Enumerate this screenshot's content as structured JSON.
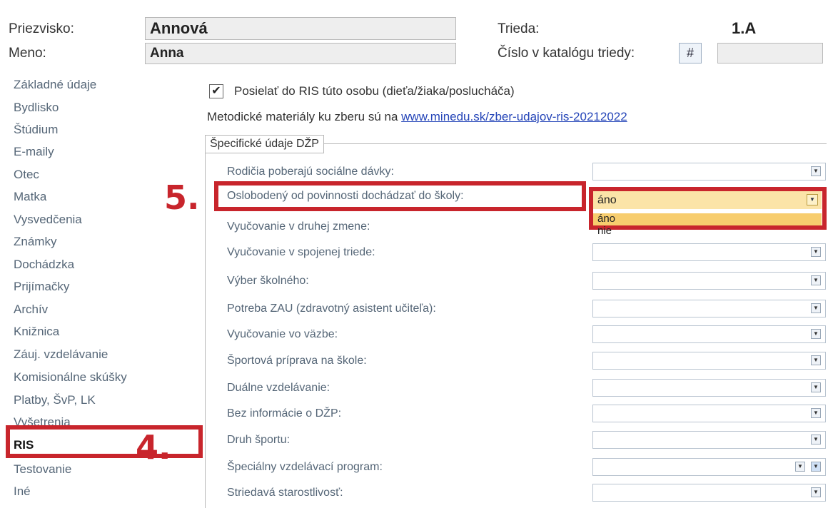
{
  "header": {
    "surname_label": "Priezvisko:",
    "surname_value": "Annová",
    "name_label": "Meno:",
    "name_value": "Anna",
    "class_label": "Trieda:",
    "class_value": "1.A",
    "catalog_label": "Číslo v katalógu triedy:",
    "hash_button": "#"
  },
  "sidebar": {
    "items": [
      "Základné údaje",
      "Bydlisko",
      "Štúdium",
      "E-maily",
      "Otec",
      "Matka",
      "Vysvedčenia",
      "Známky",
      "Dochádzka",
      "Prijímačky",
      "Archív",
      "Knižnica",
      "Záuj. vzdelávanie",
      "Komisionálne skúšky",
      "Platby, ŠvP, LK",
      "Vyšetrenia"
    ],
    "active": "RIS",
    "after_active": [
      "Testovanie",
      "Iné"
    ]
  },
  "markers": {
    "step4": "4.",
    "step5": "5."
  },
  "main": {
    "checkbox_label": "Posielať do RIS túto osobu (dieťa/žiaka/poslucháča)",
    "checkbox_checked": true,
    "info_text": "Metodické materiály ku zberu sú na",
    "info_link": "www.minedu.sk/zber-udajov-ris-20212022",
    "group_title": "Špecifické údaje DŽP",
    "fields": [
      "Rodičia poberajú sociálne dávky:",
      "Oslobodený od povinnosti dochádzať do školy:",
      "Vyučovanie v druhej zmene:",
      "Vyučovanie v spojenej triede:",
      "Výber školného:",
      "Potreba ZAU (zdravotný asistent učiteľa):",
      "Vyučovanie vo väzbe:",
      "Športová príprava na škole:",
      "Duálne vzdelávanie:",
      "Bez informácie o DŽP:",
      "Druh športu:",
      "Špeciálny vzdelávací program:",
      "Striedavá starostlivosť:"
    ],
    "selected_value": "áno",
    "dropdown_options": [
      "áno",
      "nie"
    ]
  }
}
